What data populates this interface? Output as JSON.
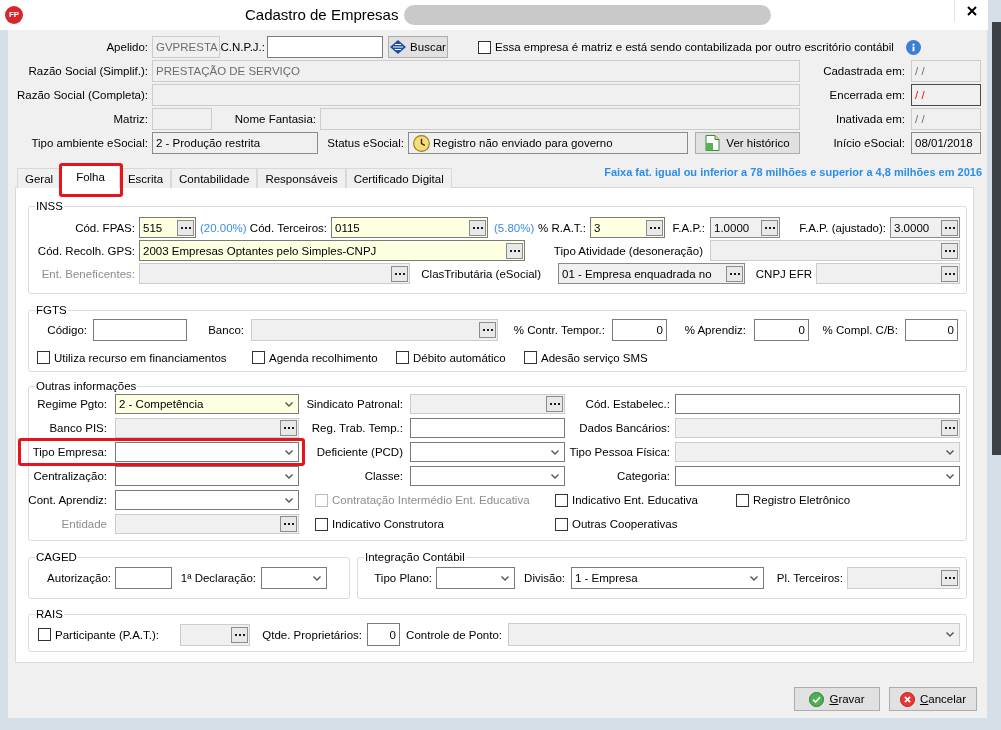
{
  "window": {
    "logo": "FP",
    "title": "Cadastro de Empresas"
  },
  "header": {
    "apelido": {
      "label": "Apelido:",
      "kind": "text",
      "disabled": true,
      "value": "GVPRESTA"
    },
    "cnpj": {
      "label": "C.N.P.J.:",
      "kind": "text",
      "disabled": false
    },
    "search_button": "Buscar",
    "matriz_option": {
      "label": "Essa empresa é matriz e está sendo contabilizada por outro escritório contábil",
      "checked": false
    },
    "razao_social_simplificada": {
      "label": "Razão Social (Simplif.):",
      "kind": "text",
      "disabled": true,
      "value": "PRESTAÇÃO DE SERVIÇO"
    },
    "cadastrada_em": {
      "label": "Cadastrada em:",
      "kind": "text",
      "disabled": true,
      "value": "/ /"
    },
    "razao_social_completa": {
      "label": "Razão Social (Completa):",
      "kind": "text",
      "disabled": true
    },
    "encerrada_em": {
      "label": "Encerrada em:",
      "kind": "text",
      "disabled": false,
      "read_only": true,
      "invalid": true,
      "value": "/ /"
    },
    "matriz": {
      "label": "Matriz:",
      "kind": "text",
      "disabled": true
    },
    "nome_fantasia": {
      "label": "Nome Fantasia:",
      "kind": "text",
      "disabled": true
    },
    "inativada_em": {
      "label": "Inativada em:",
      "kind": "text",
      "disabled": true,
      "value": "/ /"
    },
    "tipo_ambiente_esocial": {
      "label": "Tipo ambiente eSocial:",
      "kind": "text",
      "disabled": false,
      "read_only": true,
      "value": "2 - Produção restrita"
    },
    "status_esocial": {
      "label": "Status eSocial:",
      "kind": "status",
      "disabled": false,
      "read_only": true,
      "value": "Registro não enviado para governo"
    },
    "history_button": "Ver histórico",
    "inicio_esocial": {
      "label": "Início eSocial:",
      "kind": "text",
      "disabled": false,
      "read_only": true,
      "value": "08/01/2018"
    }
  },
  "tabs": [
    {
      "label": "Geral",
      "selected": false,
      "highlighted": false
    },
    {
      "label": "Folha",
      "selected": true,
      "highlighted": true
    },
    {
      "label": "Escrita",
      "selected": false,
      "highlighted": false
    },
    {
      "label": "Contabilidade",
      "selected": false,
      "highlighted": false
    },
    {
      "label": "Responsáveis",
      "selected": false,
      "highlighted": false
    },
    {
      "label": "Certificado Digital",
      "selected": false,
      "highlighted": false
    }
  ],
  "revenue_note": "Faixa fat. igual ou inferior a 78 milhões e superior a 4,8 milhões em 2016",
  "inss": {
    "title": "INSS",
    "cod_fpas": {
      "label": "Cód. FPAS:",
      "kind": "lookup",
      "disabled": false,
      "required": true,
      "value": "515"
    },
    "fpas_rate": "(20.00%)",
    "cod_terceiros": {
      "label": "Cód. Terceiros:",
      "kind": "lookup",
      "disabled": false,
      "required": true,
      "value": "0115"
    },
    "terceiros_rate": "(5.80%)",
    "rat": {
      "label": "% R.A.T.:",
      "kind": "lookup",
      "disabled": false,
      "required": true,
      "value": "3"
    },
    "fap": {
      "label": "F.A.P.:",
      "kind": "lookup",
      "disabled": false,
      "read_only": true,
      "value": "1.0000"
    },
    "fap_ajustado": {
      "label": "F.A.P. (ajustado):",
      "kind": "lookup",
      "disabled": false,
      "read_only": true,
      "value": "3.0000"
    },
    "cod_recolh_gps": {
      "label": "Cód. Recolh. GPS:",
      "kind": "lookup",
      "disabled": false,
      "required": true,
      "value": "2003 Empresas Optantes pelo Simples-CNPJ"
    },
    "tipo_atividade": {
      "label": "Tipo Atividade (desoneração)",
      "kind": "lookup",
      "disabled": true
    },
    "ent_beneficentes": {
      "label": "Ent. Beneficentes:",
      "label_disabled": true,
      "kind": "lookup",
      "disabled": true
    },
    "clas_tributaria": {
      "label": "ClasTributária (eSocial)",
      "kind": "lookup",
      "disabled": false,
      "read_only": true,
      "value": "01 - Empresa enquadrada no"
    },
    "cnpj_efr": {
      "label": "CNPJ EFR",
      "kind": "lookup",
      "disabled": true
    }
  },
  "fgts": {
    "title": "FGTS",
    "codigo": {
      "label": "Código:",
      "kind": "text",
      "disabled": false
    },
    "banco": {
      "label": "Banco:",
      "kind": "lookup",
      "disabled": true
    },
    "contr_tempor": {
      "label": "% Contr. Tempor.:",
      "kind": "text",
      "disabled": false,
      "value": "0"
    },
    "aprendiz": {
      "label": "% Aprendiz:",
      "kind": "text",
      "disabled": false,
      "value": "0"
    },
    "compl_cb": {
      "label": "% Compl. C/B:",
      "kind": "text",
      "disabled": false,
      "value": "0"
    },
    "options": [
      {
        "label": "Utiliza recurso em financiamentos",
        "checked": false
      },
      {
        "label": "Agenda recolhimento",
        "checked": false
      },
      {
        "label": "Débito automático",
        "checked": false
      },
      {
        "label": "Adesão serviço SMS",
        "checked": false
      }
    ]
  },
  "outras": {
    "title": "Outras informações",
    "regime_pgto": {
      "label": "Regime Pgto:",
      "kind": "select",
      "disabled": false,
      "required": true,
      "value": "2 - Competência"
    },
    "sindicato_patronal": {
      "label": "Sindicato Patronal:",
      "kind": "lookup",
      "disabled": true
    },
    "cod_estabelec": {
      "label": "Cód. Estabelec.:",
      "kind": "text",
      "disabled": false
    },
    "banco_pis": {
      "label": "Banco PIS:",
      "kind": "lookup",
      "disabled": true
    },
    "reg_trab_temp": {
      "label": "Reg. Trab. Temp.:",
      "kind": "text",
      "disabled": false
    },
    "dados_bancarios": {
      "label": "Dados Bancários:",
      "kind": "lookup",
      "disabled": true
    },
    "tipo_empresa": {
      "label": "Tipo Empresa:",
      "kind": "select",
      "disabled": false,
      "highlighted": true
    },
    "deficiente": {
      "label": "Deficiente (PCD)",
      "kind": "select",
      "disabled": false
    },
    "tipo_pessoa_fisica": {
      "label": "Tipo Pessoa Física:",
      "kind": "select",
      "disabled": true
    },
    "centralizacao": {
      "label": "Centralização:",
      "kind": "select",
      "disabled": false
    },
    "classe": {
      "label": "Classe:",
      "kind": "select",
      "disabled": false
    },
    "categoria": {
      "label": "Categoria:",
      "kind": "select",
      "disabled": false
    },
    "cont_aprendiz": {
      "label": "Cont. Aprendiz:",
      "kind": "select",
      "disabled": false
    },
    "options": [
      {
        "label": "Contratação Intermédio Ent. Educativa",
        "checked": false,
        "disabled": true
      },
      {
        "label": "Indicativo Ent. Educativa",
        "checked": false,
        "disabled": false
      },
      {
        "label": "Registro Eletrônico",
        "checked": false,
        "disabled": false
      },
      {
        "label": "Indicativo Construtora",
        "checked": false,
        "disabled": false
      },
      {
        "label": "Outras Cooperativas",
        "checked": false,
        "disabled": false
      }
    ],
    "entidade": {
      "label": "Entidade",
      "label_disabled": true,
      "kind": "lookup",
      "disabled": true
    }
  },
  "caged": {
    "title": "CAGED",
    "autorizacao": {
      "label": "Autorização:",
      "kind": "text",
      "disabled": false
    },
    "primeira_declaracao": {
      "label": "1ª Declaração:",
      "kind": "select",
      "disabled": false
    }
  },
  "integracao": {
    "title": "Integração Contábil",
    "tipo_plano": {
      "label": "Tipo Plano:",
      "kind": "select",
      "disabled": false
    },
    "divisao": {
      "label": "Divisão:",
      "kind": "select",
      "disabled": false,
      "value": "1 - Empresa"
    },
    "pl_terceiros": {
      "label": "Pl. Terceiros:",
      "kind": "lookup",
      "disabled": true
    }
  },
  "rais": {
    "title": "RAIS",
    "participante": {
      "label": "Participante (P.A.T.):",
      "checked": false
    },
    "pat": {
      "kind": "lookup",
      "disabled": true
    },
    "qtde_proprietarios": {
      "label": "Qtde. Proprietários:",
      "kind": "text",
      "disabled": false,
      "value": "0"
    },
    "controle_ponto": {
      "label": "Controle de Ponto:",
      "kind": "select",
      "disabled": true
    }
  },
  "buttons": [
    {
      "kind": "save",
      "label": "Gravar"
    },
    {
      "kind": "cancel",
      "label": "Cancelar"
    }
  ]
}
